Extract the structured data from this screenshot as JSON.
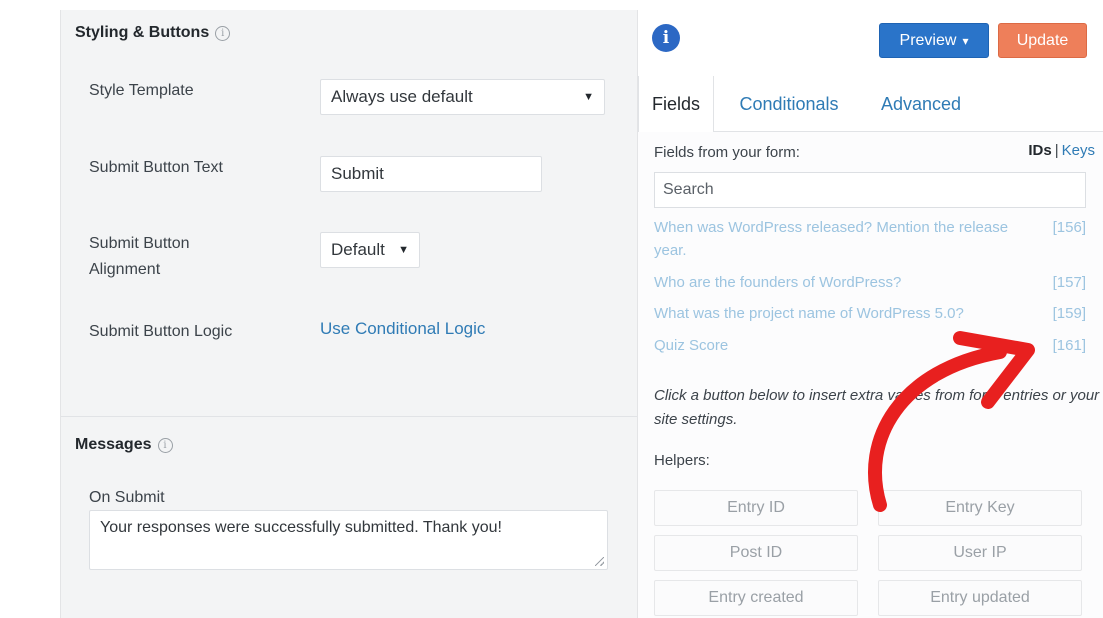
{
  "styling": {
    "heading": "Styling & Buttons",
    "info_glyph": "i",
    "style_template_label": "Style Template",
    "style_template_value": "Always use default",
    "submit_text_label": "Submit Button Text",
    "submit_text_value": "Submit",
    "alignment_label_line1": "Submit Button",
    "alignment_label_line2": "Alignment",
    "alignment_value": "Default",
    "logic_label": "Submit Button Logic",
    "logic_link": "Use Conditional Logic"
  },
  "messages": {
    "heading": "Messages",
    "info_glyph": "i",
    "on_submit_label": "On Submit",
    "on_submit_value": "Your responses were successfully submitted. Thank you!"
  },
  "toolbar": {
    "info_glyph": "i",
    "preview_label": "Preview",
    "preview_caret": "▾",
    "update_label": "Update"
  },
  "tabs": [
    {
      "label": "Fields",
      "active": true
    },
    {
      "label": "Conditionals",
      "active": false
    },
    {
      "label": "Advanced",
      "active": false
    }
  ],
  "fields_panel": {
    "label": "Fields from your form:",
    "ids_label": "IDs",
    "separator": "|",
    "keys_label": "Keys",
    "search_placeholder": "Search",
    "fields": [
      {
        "name": "When was WordPress released? Mention the release year.",
        "id": "[156]"
      },
      {
        "name": "Who are the founders of WordPress?",
        "id": "[157]"
      },
      {
        "name": "What was the project name of WordPress 5.0?",
        "id": "[159]"
      },
      {
        "name": "Quiz Score",
        "id": "[161]"
      }
    ],
    "hint": "Click a button below to insert extra values from form entries or your site settings.",
    "helpers_label": "Helpers:",
    "helpers": [
      "Entry ID",
      "Entry Key",
      "Post ID",
      "User IP",
      "Entry created",
      "Entry updated"
    ]
  },
  "colors": {
    "accent_link": "#2f7bb5",
    "preview_button": "#2a74c9",
    "update_button": "#ee7f5a",
    "annotation_arrow": "#e8201f"
  }
}
